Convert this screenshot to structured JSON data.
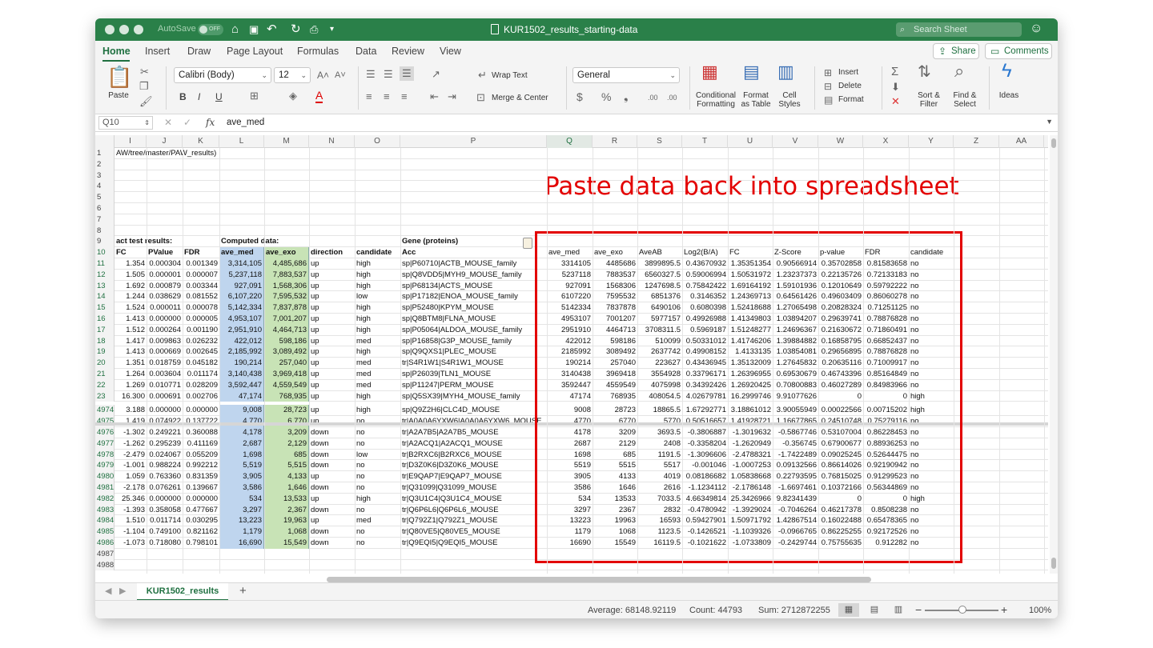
{
  "titlebar": {
    "autosave_label": "AutoSave",
    "autosave_state": "OFF",
    "doc_title": "KUR1502_results_starting-data",
    "search_placeholder": "Search Sheet"
  },
  "tabs": [
    "Home",
    "Insert",
    "Draw",
    "Page Layout",
    "Formulas",
    "Data",
    "Review",
    "View"
  ],
  "share_label": "Share",
  "comments_label": "Comments",
  "ribbon": {
    "paste": "Paste",
    "font_name": "Calibri (Body)",
    "font_size": "12",
    "wrap_text": "Wrap Text",
    "merge_center": "Merge & Center",
    "number_format": "General",
    "cond_format": [
      "Conditional",
      "Formatting"
    ],
    "format_table": [
      "Format",
      "as Table"
    ],
    "cell_styles": [
      "Cell",
      "Styles"
    ],
    "insert": "Insert",
    "delete": "Delete",
    "format": "Format",
    "sort_filter": [
      "Sort &",
      "Filter"
    ],
    "find_select": [
      "Find &",
      "Select"
    ],
    "ideas": "Ideas"
  },
  "formula_bar": {
    "name_box": "Q10",
    "fx": "fx",
    "content": "ave_med"
  },
  "column_headers": [
    "I",
    "J",
    "K",
    "L",
    "M",
    "N",
    "O",
    "P",
    "Q",
    "R",
    "S",
    "T",
    "U",
    "V",
    "W",
    "X",
    "Y",
    "Z",
    "AA"
  ],
  "overlay_text": "Paste data back into spreadsheet",
  "rows": [
    {
      "n": "1",
      "I": "AW/tree/master/PAW_results)"
    },
    {
      "n": "2"
    },
    {
      "n": "3"
    },
    {
      "n": "4"
    },
    {
      "n": "5"
    },
    {
      "n": "6"
    },
    {
      "n": "7"
    },
    {
      "n": "8"
    },
    {
      "n": "9",
      "I": "act test results:",
      "L": "Computed data:",
      "P": "Gene (proteins)"
    },
    {
      "n": "10",
      "I": "FC",
      "J": "PValue",
      "K": "FDR",
      "L": "ave_med",
      "M": "ave_exo",
      "N": "direction",
      "O": "candidate",
      "P": "Acc",
      "Q": "ave_med",
      "R": "ave_exo",
      "S": "AveAB",
      "T": "Log2(B/A)",
      "U": "FC",
      "V": "Z-Score",
      "W": "p-value",
      "X": "FDR",
      "Y": "candidate"
    },
    {
      "n": "11",
      "I": "1.354",
      "J": "0.000304",
      "K": "0.001349",
      "L": "3,314,105",
      "M": "4,485,686",
      "N": "up",
      "O": "high",
      "P": "sp|P60710|ACTB_MOUSE_family",
      "Q": "3314105",
      "R": "4485686",
      "S": "3899895.5",
      "T": "0.43670932",
      "U": "1.35351354",
      "V": "0.90566914",
      "W": "0.35702858",
      "X": "0.81583658",
      "Y": "no"
    },
    {
      "n": "12",
      "I": "1.505",
      "J": "0.000001",
      "K": "0.000007",
      "L": "5,237,118",
      "M": "7,883,537",
      "N": "up",
      "O": "high",
      "P": "sp|Q8VDD5|MYH9_MOUSE_family",
      "Q": "5237118",
      "R": "7883537",
      "S": "6560327.5",
      "T": "0.59006994",
      "U": "1.50531972",
      "V": "1.23237373",
      "W": "0.22135726",
      "X": "0.72133183",
      "Y": "no"
    },
    {
      "n": "13",
      "I": "1.692",
      "J": "0.000879",
      "K": "0.003344",
      "L": "927,091",
      "M": "1,568,306",
      "N": "up",
      "O": "high",
      "P": "sp|P68134|ACTS_MOUSE",
      "Q": "927091",
      "R": "1568306",
      "S": "1247698.5",
      "T": "0.75842422",
      "U": "1.69164192",
      "V": "1.59101936",
      "W": "0.12010649",
      "X": "0.59792222",
      "Y": "no"
    },
    {
      "n": "14",
      "I": "1.244",
      "J": "0.038629",
      "K": "0.081552",
      "L": "6,107,220",
      "M": "7,595,532",
      "N": "up",
      "O": "low",
      "P": "sp|P17182|ENOA_MOUSE_family",
      "Q": "6107220",
      "R": "7595532",
      "S": "6851376",
      "T": "0.3146352",
      "U": "1.24369713",
      "V": "0.64561426",
      "W": "0.49603409",
      "X": "0.86060278",
      "Y": "no"
    },
    {
      "n": "15",
      "I": "1.524",
      "J": "0.000011",
      "K": "0.000078",
      "L": "5,142,334",
      "M": "7,837,878",
      "N": "up",
      "O": "high",
      "P": "sp|P52480|KPYM_MOUSE",
      "Q": "5142334",
      "R": "7837878",
      "S": "6490106",
      "T": "0.6080398",
      "U": "1.52418688",
      "V": "1.27065498",
      "W": "0.20828324",
      "X": "0.71251125",
      "Y": "no"
    },
    {
      "n": "16",
      "I": "1.413",
      "J": "0.000000",
      "K": "0.000005",
      "L": "4,953,107",
      "M": "7,001,207",
      "N": "up",
      "O": "high",
      "P": "sp|Q8BTM8|FLNA_MOUSE",
      "Q": "4953107",
      "R": "7001207",
      "S": "5977157",
      "T": "0.49926988",
      "U": "1.41349803",
      "V": "1.03894207",
      "W": "0.29639741",
      "X": "0.78876828",
      "Y": "no"
    },
    {
      "n": "17",
      "I": "1.512",
      "J": "0.000264",
      "K": "0.001190",
      "L": "2,951,910",
      "M": "4,464,713",
      "N": "up",
      "O": "high",
      "P": "sp|P05064|ALDOA_MOUSE_family",
      "Q": "2951910",
      "R": "4464713",
      "S": "3708311.5",
      "T": "0.5969187",
      "U": "1.51248277",
      "V": "1.24696367",
      "W": "0.21630672",
      "X": "0.71860491",
      "Y": "no"
    },
    {
      "n": "18",
      "I": "1.417",
      "J": "0.009863",
      "K": "0.026232",
      "L": "422,012",
      "M": "598,186",
      "N": "up",
      "O": "med",
      "P": "sp|P16858|G3P_MOUSE_family",
      "Q": "422012",
      "R": "598186",
      "S": "510099",
      "T": "0.50331012",
      "U": "1.41746206",
      "V": "1.39884882",
      "W": "0.16858795",
      "X": "0.66852437",
      "Y": "no"
    },
    {
      "n": "19",
      "I": "1.413",
      "J": "0.000669",
      "K": "0.002645",
      "L": "2,185,992",
      "M": "3,089,492",
      "N": "up",
      "O": "high",
      "P": "sp|Q9QXS1|PLEC_MOUSE",
      "Q": "2185992",
      "R": "3089492",
      "S": "2637742",
      "T": "0.49908152",
      "U": "1.4133135",
      "V": "1.03854081",
      "W": "0.29656895",
      "X": "0.78876828",
      "Y": "no"
    },
    {
      "n": "20",
      "I": "1.351",
      "J": "0.018759",
      "K": "0.045182",
      "L": "190,214",
      "M": "257,040",
      "N": "up",
      "O": "med",
      "P": "tr|S4R1W1|S4R1W1_MOUSE",
      "Q": "190214",
      "R": "257040",
      "S": "223627",
      "T": "0.43436945",
      "U": "1.35132009",
      "V": "1.27645832",
      "W": "0.20635116",
      "X": "0.71009917",
      "Y": "no"
    },
    {
      "n": "21",
      "I": "1.264",
      "J": "0.003604",
      "K": "0.011174",
      "L": "3,140,438",
      "M": "3,969,418",
      "N": "up",
      "O": "med",
      "P": "sp|P26039|TLN1_MOUSE",
      "Q": "3140438",
      "R": "3969418",
      "S": "3554928",
      "T": "0.33796171",
      "U": "1.26396955",
      "V": "0.69530679",
      "W": "0.46743396",
      "X": "0.85164849",
      "Y": "no"
    },
    {
      "n": "22",
      "I": "1.269",
      "J": "0.010771",
      "K": "0.028209",
      "L": "3,592,447",
      "M": "4,559,549",
      "N": "up",
      "O": "med",
      "P": "sp|P11247|PERM_MOUSE",
      "Q": "3592447",
      "R": "4559549",
      "S": "4075998",
      "T": "0.34392426",
      "U": "1.26920425",
      "V": "0.70800883",
      "W": "0.46027289",
      "X": "0.84983966",
      "Y": "no"
    },
    {
      "n": "23",
      "I": "16.300",
      "J": "0.000691",
      "K": "0.002706",
      "L": "47,174",
      "M": "768,935",
      "N": "up",
      "O": "high",
      "P": "sp|Q5SX39|MYH4_MOUSE_family",
      "Q": "47174",
      "R": "768935",
      "S": "408054.5",
      "T": "4.02679781",
      "U": "16.2999746",
      "V": "9.91077626",
      "W": "0",
      "X": "0",
      "Y": "high"
    },
    {
      "n": "4974",
      "I": "3.188",
      "J": "0.000000",
      "K": "0.000000",
      "L": "9,008",
      "M": "28,723",
      "N": "up",
      "O": "high",
      "P": "sp|Q9Z2H6|CLC4D_MOUSE",
      "Q": "9008",
      "R": "28723",
      "S": "18865.5",
      "T": "1.67292771",
      "U": "3.18861012",
      "V": "3.90055949",
      "W": "0.00022566",
      "X": "0.00715202",
      "Y": "high"
    },
    {
      "n": "4975",
      "I": "1.419",
      "J": "0.074922",
      "K": "0.137722",
      "L": "4,770",
      "M": "6,770",
      "N": "up",
      "O": "no",
      "P": "tr|A0A0A6YXW6|A0A0A6YXW6_MOUSE",
      "Q": "4770",
      "R": "6770",
      "S": "5770",
      "T": "0.50516657",
      "U": "1.41928721",
      "V": "1.16677865",
      "W": "0.24510748",
      "X": "0.75279116",
      "Y": "no"
    },
    {
      "n": "4976",
      "I": "-1.302",
      "J": "0.249221",
      "K": "0.360088",
      "L": "4,178",
      "M": "3,209",
      "N": "down",
      "O": "no",
      "P": "tr|A2A7B5|A2A7B5_MOUSE",
      "Q": "4178",
      "R": "3209",
      "S": "3693.5",
      "T": "-0.3806887",
      "U": "-1.3019632",
      "V": "-0.5867746",
      "W": "0.53107004",
      "X": "0.86228453",
      "Y": "no"
    },
    {
      "n": "4977",
      "I": "-1.262",
      "J": "0.295239",
      "K": "0.411169",
      "L": "2,687",
      "M": "2,129",
      "N": "down",
      "O": "no",
      "P": "tr|A2ACQ1|A2ACQ1_MOUSE",
      "Q": "2687",
      "R": "2129",
      "S": "2408",
      "T": "-0.3358204",
      "U": "-1.2620949",
      "V": "-0.356745",
      "W": "0.67900677",
      "X": "0.88936253",
      "Y": "no"
    },
    {
      "n": "4978",
      "I": "-2.479",
      "J": "0.024067",
      "K": "0.055209",
      "L": "1,698",
      "M": "685",
      "N": "down",
      "O": "low",
      "P": "tr|B2RXC6|B2RXC6_MOUSE",
      "Q": "1698",
      "R": "685",
      "S": "1191.5",
      "T": "-1.3096606",
      "U": "-2.4788321",
      "V": "-1.7422489",
      "W": "0.09025245",
      "X": "0.52644475",
      "Y": "no"
    },
    {
      "n": "4979",
      "I": "-1.001",
      "J": "0.988224",
      "K": "0.992212",
      "L": "5,519",
      "M": "5,515",
      "N": "down",
      "O": "no",
      "P": "tr|D3Z0K6|D3Z0K6_MOUSE",
      "Q": "5519",
      "R": "5515",
      "S": "5517",
      "T": "-0.001046",
      "U": "-1.0007253",
      "V": "0.09132566",
      "W": "0.86614026",
      "X": "0.92190942",
      "Y": "no"
    },
    {
      "n": "4980",
      "I": "1.059",
      "J": "0.763360",
      "K": "0.831359",
      "L": "3,905",
      "M": "4,133",
      "N": "up",
      "O": "no",
      "P": "tr|E9QAP7|E9QAP7_MOUSE",
      "Q": "3905",
      "R": "4133",
      "S": "4019",
      "T": "0.08186682",
      "U": "1.05838668",
      "V": "0.22793595",
      "W": "0.76815025",
      "X": "0.91299523",
      "Y": "no"
    },
    {
      "n": "4981",
      "I": "-2.178",
      "J": "0.076261",
      "K": "0.139667",
      "L": "3,586",
      "M": "1,646",
      "N": "down",
      "O": "no",
      "P": "tr|Q31099|Q31099_MOUSE",
      "Q": "3586",
      "R": "1646",
      "S": "2616",
      "T": "-1.1234112",
      "U": "-2.1786148",
      "V": "-1.6697461",
      "W": "0.10372166",
      "X": "0.56344869",
      "Y": "no"
    },
    {
      "n": "4982",
      "I": "25.346",
      "J": "0.000000",
      "K": "0.000000",
      "L": "534",
      "M": "13,533",
      "N": "up",
      "O": "high",
      "P": "tr|Q3U1C4|Q3U1C4_MOUSE",
      "Q": "534",
      "R": "13533",
      "S": "7033.5",
      "T": "4.66349814",
      "U": "25.3426966",
      "V": "9.82341439",
      "W": "0",
      "X": "0",
      "Y": "high"
    },
    {
      "n": "4983",
      "I": "-1.393",
      "J": "0.358058",
      "K": "0.477667",
      "L": "3,297",
      "M": "2,367",
      "N": "down",
      "O": "no",
      "P": "tr|Q6P6L6|Q6P6L6_MOUSE",
      "Q": "3297",
      "R": "2367",
      "S": "2832",
      "T": "-0.4780942",
      "U": "-1.3929024",
      "V": "-0.7046264",
      "W": "0.46217378",
      "X": "0.8508238",
      "Y": "no"
    },
    {
      "n": "4984",
      "I": "1.510",
      "J": "0.011714",
      "K": "0.030295",
      "L": "13,223",
      "M": "19,963",
      "N": "up",
      "O": "med",
      "P": "tr|Q792Z1|Q792Z1_MOUSE",
      "Q": "13223",
      "R": "19963",
      "S": "16593",
      "T": "0.59427901",
      "U": "1.50971792",
      "V": "1.42867514",
      "W": "0.16022488",
      "X": "0.65478365",
      "Y": "no"
    },
    {
      "n": "4985",
      "I": "-1.104",
      "J": "0.749100",
      "K": "0.821162",
      "L": "1,179",
      "M": "1,068",
      "N": "down",
      "O": "no",
      "P": "tr|Q80VE5|Q80VE5_MOUSE",
      "Q": "1179",
      "R": "1068",
      "S": "1123.5",
      "T": "-0.1426521",
      "U": "-1.1039326",
      "V": "-0.0966765",
      "W": "0.86225255",
      "X": "0.92172526",
      "Y": "no"
    },
    {
      "n": "4986",
      "I": "-1.073",
      "J": "0.718080",
      "K": "0.798101",
      "L": "16,690",
      "M": "15,549",
      "N": "down",
      "O": "no",
      "P": "tr|Q9EQI5|Q9EQI5_MOUSE",
      "Q": "16690",
      "R": "15549",
      "S": "16119.5",
      "T": "-0.1021622",
      "U": "-1.0733809",
      "V": "-0.2429744",
      "W": "0.75755635",
      "X": "0.912282",
      "Y": "no"
    },
    {
      "n": "4987"
    },
    {
      "n": "4988"
    }
  ],
  "sheet_tab": "KUR1502_results",
  "status": {
    "average": "Average: 68148.92119",
    "count": "Count: 44793",
    "sum": "Sum: 2712872255",
    "zoom": "100%"
  },
  "colors": {
    "excel_green": "#2a8049",
    "annotation_red": "#e30000",
    "highlight_blue": "#bfd5ee",
    "highlight_green": "#c8e3b6"
  }
}
